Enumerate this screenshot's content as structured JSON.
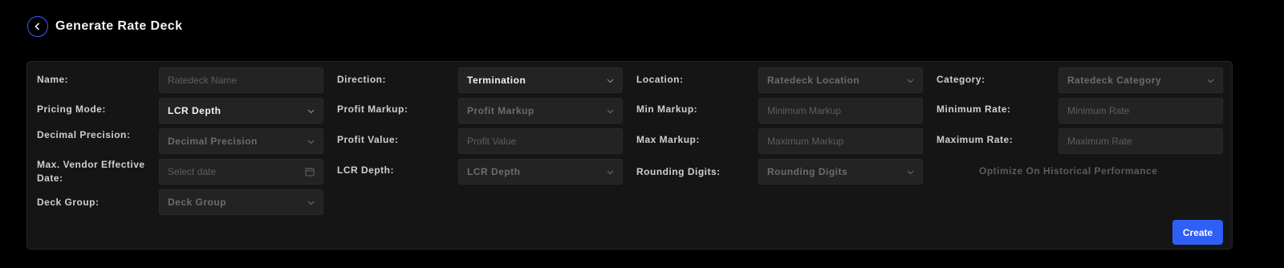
{
  "header": {
    "title": "Generate Rate Deck"
  },
  "form": {
    "name": {
      "label": "Name:",
      "placeholder": "Ratedeck Name"
    },
    "pricing_mode": {
      "label": "Pricing Mode:",
      "value": "LCR Depth"
    },
    "decimal_precision": {
      "label": "Decimal Precision:",
      "placeholder": "Decimal Precision"
    },
    "max_vendor_date": {
      "label": "Max. Vendor Effective Date:",
      "placeholder": "Select date"
    },
    "deck_group": {
      "label": "Deck Group:",
      "placeholder": "Deck Group"
    },
    "direction": {
      "label": "Direction:",
      "value": "Termination"
    },
    "profit_markup": {
      "label": "Profit Markup:",
      "placeholder": "Profit Markup"
    },
    "profit_value": {
      "label": "Profit Value:",
      "placeholder": "Profit Value"
    },
    "lcr_depth": {
      "label": "LCR Depth:",
      "placeholder": "LCR Depth"
    },
    "location": {
      "label": "Location:",
      "placeholder": "Ratedeck Location"
    },
    "min_markup": {
      "label": "Min Markup:",
      "placeholder": "Minimum Markup"
    },
    "max_markup": {
      "label": "Max Markup:",
      "placeholder": "Maximum Markup"
    },
    "rounding_digits": {
      "label": "Rounding Digits:",
      "placeholder": "Rounding Digits"
    },
    "category": {
      "label": "Category:",
      "placeholder": "Ratedeck Category"
    },
    "minimum_rate": {
      "label": "Minimum Rate:",
      "placeholder": "Minimum Rate"
    },
    "maximum_rate": {
      "label": "Maximum Rate:",
      "placeholder": "Maximum Rate"
    },
    "optimize": {
      "label": "Optimize On Historical Performance",
      "checked": false
    },
    "create_label": "Create"
  },
  "colors": {
    "accent": "#2f5ff5",
    "back_ring": "#3b5cff",
    "card_bg": "#151515",
    "field_bg": "#232323"
  },
  "icons": {
    "back": "chevron-left-icon",
    "select": "chevron-down-icon",
    "date": "calendar-icon"
  }
}
